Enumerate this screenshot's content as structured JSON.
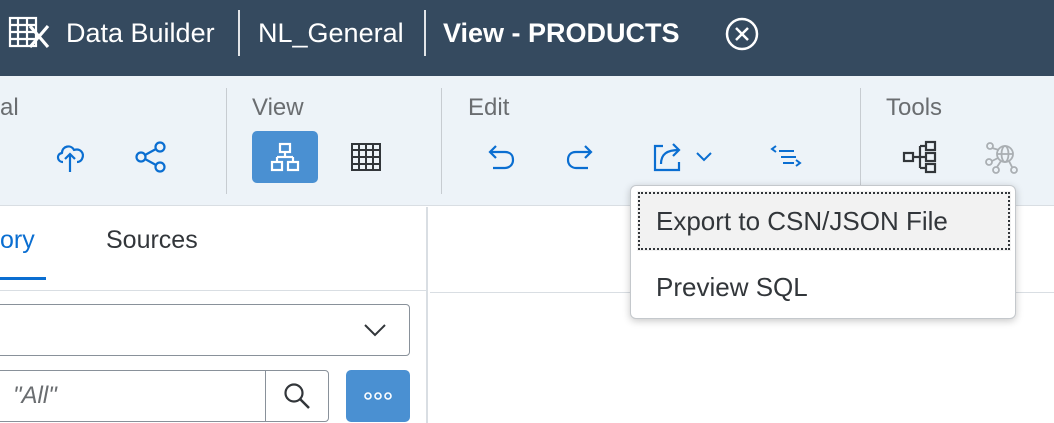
{
  "shell": {
    "app_name": "Data Builder",
    "space": "NL_General",
    "view_title": "View - PRODUCTS",
    "icons": {
      "app": "data-builder-icon",
      "close": "close-circle-icon"
    }
  },
  "toolbar": {
    "groups": {
      "general": {
        "label": "al"
      },
      "view": {
        "label": "View"
      },
      "edit": {
        "label": "Edit"
      },
      "tools": {
        "label": "Tools"
      }
    },
    "buttons": {
      "deploy": {
        "icon": "cloud-upload-icon"
      },
      "share": {
        "icon": "share-icon"
      },
      "diagram_view": {
        "icon": "hierarchy-icon",
        "state": "selected"
      },
      "data_view": {
        "icon": "table-icon"
      },
      "undo": {
        "icon": "undo-icon"
      },
      "redo": {
        "icon": "redo-icon"
      },
      "export": {
        "icon": "export-icon",
        "has_dropdown": true
      },
      "sql": {
        "icon": "sql-icon"
      },
      "impact_lineage": {
        "icon": "lineage-icon"
      },
      "network": {
        "icon": "network-icon",
        "state": "disabled"
      }
    }
  },
  "left_panel": {
    "tabs": [
      {
        "label": "ory",
        "selected": true
      },
      {
        "label": "Sources",
        "selected": false
      }
    ],
    "dropdown": {
      "value": ""
    },
    "search": {
      "placeholder": "\"All\""
    },
    "icons": {
      "chevron": "chevron-down-icon",
      "search": "search-icon",
      "more": "more-icon"
    }
  },
  "export_menu": {
    "items": [
      {
        "label": "Export to CSN/JSON File",
        "focused": true
      },
      {
        "label": "Preview SQL",
        "focused": false
      }
    ]
  },
  "colors": {
    "shell_bg": "#354a5f",
    "toolbar_bg": "#edf3f8",
    "accent": "#4a90d2",
    "icon": "#0a6ed1",
    "text": "#32363a",
    "muted_text": "#6a6d70"
  }
}
